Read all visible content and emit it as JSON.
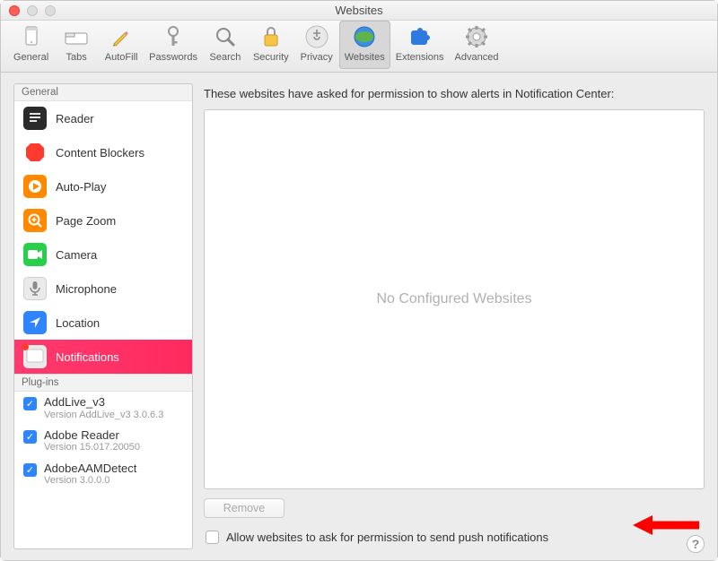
{
  "window": {
    "title": "Websites"
  },
  "toolbar": {
    "items": [
      {
        "label": "General"
      },
      {
        "label": "Tabs"
      },
      {
        "label": "AutoFill"
      },
      {
        "label": "Passwords"
      },
      {
        "label": "Search"
      },
      {
        "label": "Security"
      },
      {
        "label": "Privacy"
      },
      {
        "label": "Websites"
      },
      {
        "label": "Extensions"
      },
      {
        "label": "Advanced"
      }
    ]
  },
  "sidebar": {
    "section1_header": "General",
    "items": [
      {
        "label": "Reader"
      },
      {
        "label": "Content Blockers"
      },
      {
        "label": "Auto-Play"
      },
      {
        "label": "Page Zoom"
      },
      {
        "label": "Camera"
      },
      {
        "label": "Microphone"
      },
      {
        "label": "Location"
      },
      {
        "label": "Notifications"
      }
    ],
    "section2_header": "Plug-ins",
    "plugins": [
      {
        "name": "AddLive_v3",
        "version": "Version AddLive_v3 3.0.6.3"
      },
      {
        "name": "Adobe Reader",
        "version": "Version 15.017.20050"
      },
      {
        "name": "AdobeAAMDetect",
        "version": "Version 3.0.0.0"
      }
    ]
  },
  "main": {
    "description": "These websites have asked for permission to show alerts in Notification Center:",
    "empty_text": "No Configured Websites",
    "remove_label": "Remove",
    "allow_label": "Allow websites to ask for permission to send push notifications"
  }
}
